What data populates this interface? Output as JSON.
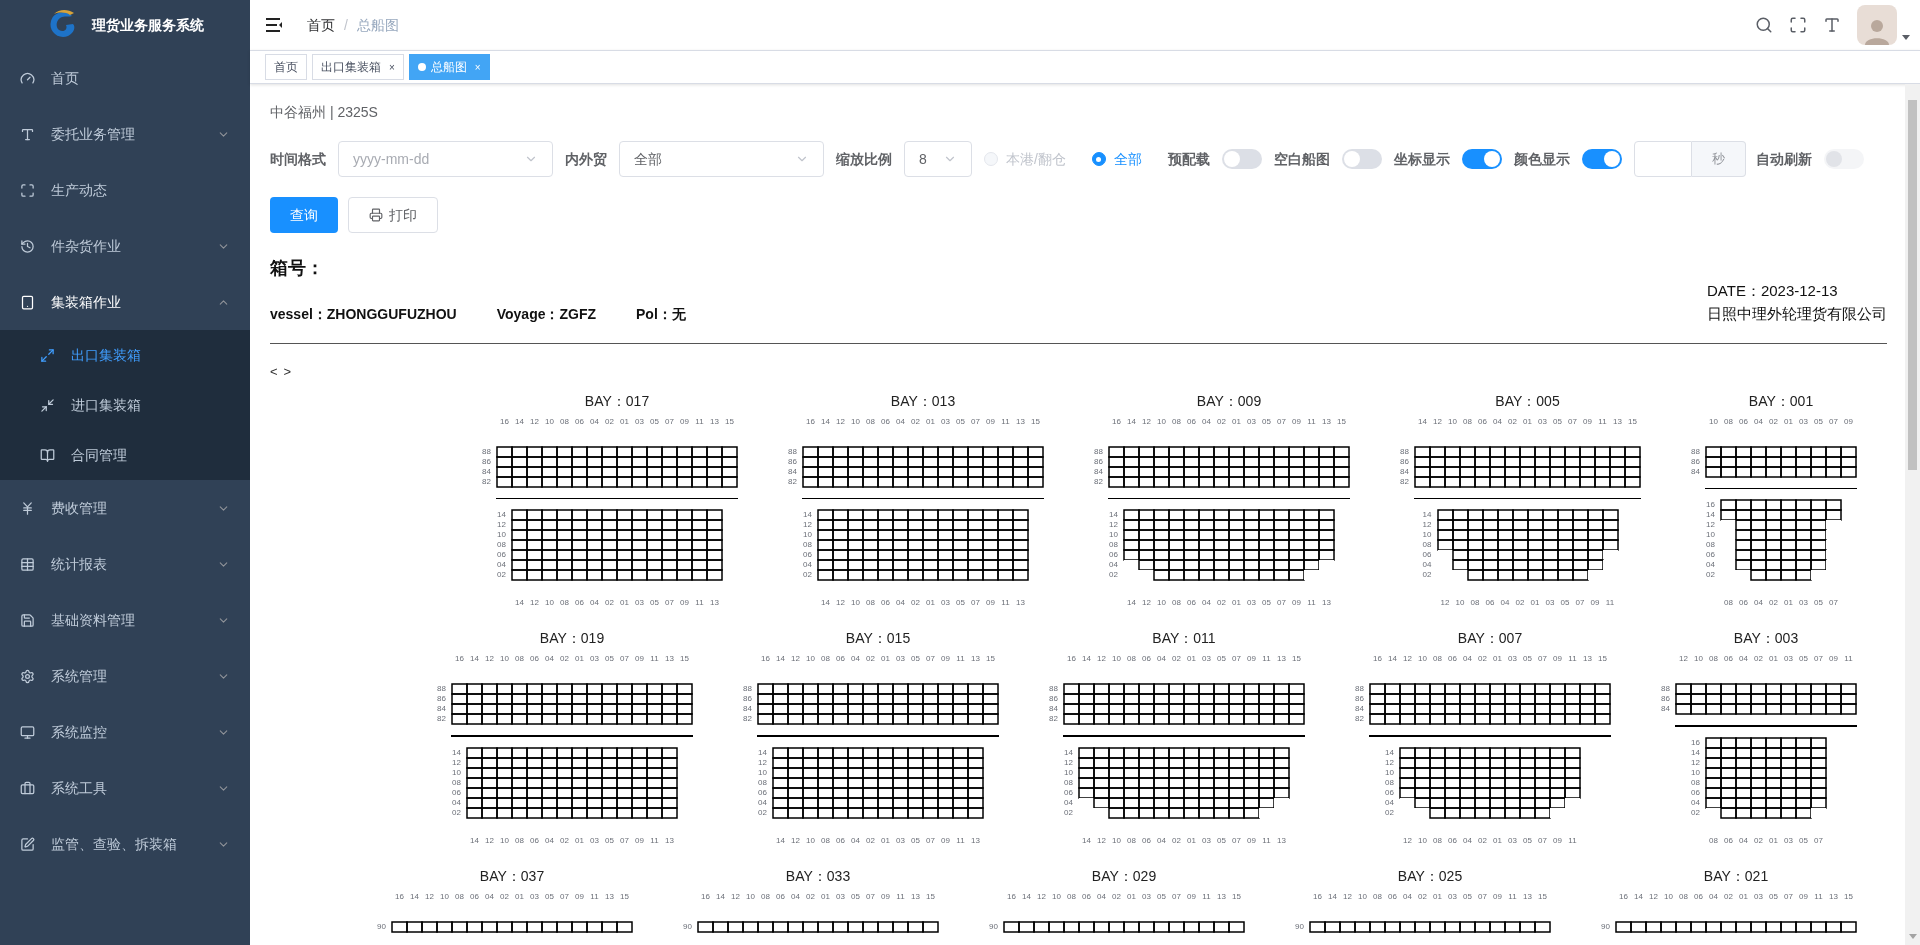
{
  "sidebar": {
    "title": "理货业务服务系统",
    "items": [
      {
        "label": "首页",
        "selected": false
      },
      {
        "label": "委托业务管理",
        "selected": false,
        "expanded": false
      },
      {
        "label": "生产动态",
        "selected": false
      },
      {
        "label": "件杂货作业",
        "selected": false,
        "expanded": false
      },
      {
        "label": "集装箱作业",
        "selected": true,
        "expanded": true,
        "children": [
          {
            "label": "出口集装箱",
            "selected": true
          },
          {
            "label": "进口集装箱",
            "selected": false
          },
          {
            "label": "合同管理",
            "selected": false
          }
        ]
      },
      {
        "label": "费收管理",
        "selected": false,
        "expanded": false
      },
      {
        "label": "统计报表",
        "selected": false,
        "expanded": false
      },
      {
        "label": "基础资料管理",
        "selected": false,
        "expanded": false
      },
      {
        "label": "系统管理",
        "selected": false,
        "expanded": false
      },
      {
        "label": "系统监控",
        "selected": false,
        "expanded": false
      },
      {
        "label": "系统工具",
        "selected": false,
        "expanded": false
      },
      {
        "label": "监管、查验、拆装箱",
        "selected": false,
        "expanded": false
      }
    ]
  },
  "header": {
    "breadcrumb": [
      {
        "label": "首页",
        "current": false
      },
      {
        "label": "总船图",
        "current": true
      }
    ],
    "separator": "/"
  },
  "tags": [
    {
      "label": "首页",
      "selected": false
    },
    {
      "label": "出口集装箱",
      "selected": false,
      "close": "×"
    },
    {
      "label": "总船图",
      "selected": true,
      "close": "×"
    }
  ],
  "page": {
    "ship": "中谷福州 | 2325S",
    "filters": [
      {
        "kind": "select",
        "label": "时间格式",
        "placeholder": "yyyy-mm-dd"
      },
      {
        "kind": "select",
        "label": "内外贸",
        "value": "全部"
      },
      {
        "kind": "select",
        "label": "缩放比例",
        "value": "8"
      },
      {
        "kind": "radio",
        "label": "本港/翻仓",
        "selected": false,
        "disabled": true
      },
      {
        "kind": "radio",
        "label": "全部",
        "selected": true,
        "disabled": false
      },
      {
        "kind": "switch",
        "label": "预配载",
        "on": false,
        "disabled": false
      },
      {
        "kind": "switch",
        "label": "空白船图",
        "on": false,
        "disabled": false
      },
      {
        "kind": "switch",
        "label": "坐标显示",
        "on": true,
        "disabled": false
      },
      {
        "kind": "switch",
        "label": "颜色显示",
        "on": true,
        "disabled": false
      },
      {
        "kind": "input",
        "addon": "秒"
      },
      {
        "kind": "switch",
        "label": "自动刷新",
        "on": false,
        "disabled": true
      }
    ],
    "buttons": [
      {
        "kind": "primary",
        "label": "查询"
      },
      {
        "kind": "print",
        "label": "打印"
      }
    ],
    "info": {
      "heading": "箱号：",
      "vessel": "vessel：ZHONGGUFUZHOU",
      "voyage": "Voyage：ZGFZ",
      "pol": "Pol：无",
      "date": "DATE：2023-12-13",
      "company": "日照中理外轮理货有限公司"
    },
    "pager": [
      "<",
      ">"
    ],
    "bay_rows": [
      [
        {
          "title": "BAY：017",
          "deck_columns": [
            "16",
            "14",
            "12",
            "10",
            "08",
            "06",
            "04",
            "02",
            "01",
            "03",
            "05",
            "07",
            "09",
            "11",
            "13",
            "15"
          ],
          "deck_tiers": [
            "88",
            "86",
            "84",
            "82"
          ],
          "hold_tiers": [
            {
              "label": "14"
            },
            {
              "label": "12"
            },
            {
              "label": "10"
            },
            {
              "label": "08"
            },
            {
              "label": "06"
            },
            {
              "label": "04"
            },
            {
              "label": "02"
            }
          ],
          "hold_columns": [
            "14",
            "12",
            "10",
            "08",
            "06",
            "04",
            "02",
            "01",
            "03",
            "05",
            "07",
            "09",
            "11",
            "13"
          ]
        },
        {
          "title": "BAY：013",
          "deck_columns": [
            "16",
            "14",
            "12",
            "10",
            "08",
            "06",
            "04",
            "02",
            "01",
            "03",
            "05",
            "07",
            "09",
            "11",
            "13",
            "15"
          ],
          "deck_tiers": [
            "88",
            "86",
            "84",
            "82"
          ],
          "hold_tiers": [
            {
              "label": "14"
            },
            {
              "label": "12"
            },
            {
              "label": "10"
            },
            {
              "label": "08"
            },
            {
              "label": "06"
            },
            {
              "label": "04"
            },
            {
              "label": "02"
            }
          ],
          "hold_columns": [
            "14",
            "12",
            "10",
            "08",
            "06",
            "04",
            "02",
            "01",
            "03",
            "05",
            "07",
            "09",
            "11",
            "13"
          ]
        },
        {
          "title": "BAY：009",
          "deck_columns": [
            "16",
            "14",
            "12",
            "10",
            "08",
            "06",
            "04",
            "02",
            "01",
            "03",
            "05",
            "07",
            "09",
            "11",
            "13",
            "15"
          ],
          "deck_tiers": [
            "88",
            "86",
            "84",
            "82"
          ],
          "hold_tiers": [
            {
              "label": "14"
            },
            {
              "label": "12"
            },
            {
              "label": "10"
            },
            {
              "label": "08"
            },
            {
              "label": "06"
            },
            {
              "label": "04",
              "slots": [
                false,
                true,
                true,
                true,
                true,
                true,
                true,
                true,
                true,
                true,
                true,
                true,
                true,
                false
              ]
            },
            {
              "label": "02",
              "slots": [
                false,
                false,
                true,
                true,
                true,
                true,
                true,
                true,
                true,
                true,
                true,
                true,
                false,
                false
              ]
            }
          ],
          "hold_columns": [
            "14",
            "12",
            "10",
            "08",
            "06",
            "04",
            "02",
            "01",
            "03",
            "05",
            "07",
            "09",
            "11",
            "13"
          ]
        },
        {
          "title": "BAY：005",
          "deck_columns": [
            "14",
            "12",
            "10",
            "08",
            "06",
            "04",
            "02",
            "01",
            "03",
            "05",
            "07",
            "09",
            "11",
            "13",
            "15"
          ],
          "deck_tiers": [
            "88",
            "86",
            "84",
            "82"
          ],
          "hold_tiers": [
            {
              "label": "14"
            },
            {
              "label": "12"
            },
            {
              "label": "10"
            },
            {
              "label": "08"
            },
            {
              "label": "06",
              "slots": [
                false,
                true,
                true,
                true,
                true,
                true,
                true,
                true,
                true,
                true,
                true,
                false
              ]
            },
            {
              "label": "04",
              "slots": [
                false,
                true,
                true,
                true,
                true,
                true,
                true,
                true,
                true,
                true,
                true,
                false
              ]
            },
            {
              "label": "02",
              "slots": [
                false,
                false,
                true,
                true,
                true,
                true,
                true,
                true,
                true,
                true,
                false,
                false
              ]
            }
          ],
          "hold_columns": [
            "12",
            "10",
            "08",
            "06",
            "04",
            "02",
            "01",
            "03",
            "05",
            "07",
            "09",
            "11"
          ]
        },
        {
          "title": "BAY：001",
          "deck_columns": [
            "10",
            "08",
            "06",
            "04",
            "02",
            "01",
            "03",
            "05",
            "07",
            "09"
          ],
          "deck_tiers": [
            "88",
            "86",
            "84"
          ],
          "hold_tiers": [
            {
              "label": "16"
            },
            {
              "label": "14"
            },
            {
              "label": "12",
              "slots": [
                false,
                true,
                true,
                true,
                true,
                true,
                true,
                false
              ]
            },
            {
              "label": "10",
              "slots": [
                false,
                true,
                true,
                true,
                true,
                true,
                true,
                false
              ]
            },
            {
              "label": "08",
              "slots": [
                false,
                true,
                true,
                true,
                true,
                true,
                true,
                false
              ]
            },
            {
              "label": "06",
              "slots": [
                false,
                true,
                true,
                true,
                true,
                true,
                true,
                false
              ]
            },
            {
              "label": "04",
              "slots": [
                false,
                true,
                true,
                true,
                true,
                true,
                true,
                false
              ]
            },
            {
              "label": "02",
              "slots": [
                false,
                false,
                true,
                true,
                true,
                true,
                false,
                false
              ]
            }
          ],
          "hold_columns": [
            "08",
            "06",
            "04",
            "02",
            "01",
            "03",
            "05",
            "07"
          ]
        }
      ],
      [
        {
          "title": "BAY：019",
          "deck_columns": [
            "16",
            "14",
            "12",
            "10",
            "08",
            "06",
            "04",
            "02",
            "01",
            "03",
            "05",
            "07",
            "09",
            "11",
            "13",
            "15"
          ],
          "deck_tiers": [
            "88",
            "86",
            "84",
            "82"
          ],
          "hold_tiers": [
            {
              "label": "14"
            },
            {
              "label": "12"
            },
            {
              "label": "10"
            },
            {
              "label": "08"
            },
            {
              "label": "06"
            },
            {
              "label": "04"
            },
            {
              "label": "02"
            }
          ],
          "hold_columns": [
            "14",
            "12",
            "10",
            "08",
            "06",
            "04",
            "02",
            "01",
            "03",
            "05",
            "07",
            "09",
            "11",
            "13"
          ]
        },
        {
          "title": "BAY：015",
          "deck_columns": [
            "16",
            "14",
            "12",
            "10",
            "08",
            "06",
            "04",
            "02",
            "01",
            "03",
            "05",
            "07",
            "09",
            "11",
            "13",
            "15"
          ],
          "deck_tiers": [
            "88",
            "86",
            "84",
            "82"
          ],
          "hold_tiers": [
            {
              "label": "14"
            },
            {
              "label": "12"
            },
            {
              "label": "10"
            },
            {
              "label": "08"
            },
            {
              "label": "06"
            },
            {
              "label": "04"
            },
            {
              "label": "02"
            }
          ],
          "hold_columns": [
            "14",
            "12",
            "10",
            "08",
            "06",
            "04",
            "02",
            "01",
            "03",
            "05",
            "07",
            "09",
            "11",
            "13"
          ]
        },
        {
          "title": "BAY：011",
          "deck_columns": [
            "16",
            "14",
            "12",
            "10",
            "08",
            "06",
            "04",
            "02",
            "01",
            "03",
            "05",
            "07",
            "09",
            "11",
            "13",
            "15"
          ],
          "deck_tiers": [
            "88",
            "86",
            "84",
            "82"
          ],
          "hold_tiers": [
            {
              "label": "14"
            },
            {
              "label": "12"
            },
            {
              "label": "10"
            },
            {
              "label": "08"
            },
            {
              "label": "06"
            },
            {
              "label": "04",
              "slots": [
                false,
                true,
                true,
                true,
                true,
                true,
                true,
                true,
                true,
                true,
                true,
                true,
                true,
                false
              ]
            },
            {
              "label": "02",
              "slots": [
                false,
                false,
                true,
                true,
                true,
                true,
                true,
                true,
                true,
                true,
                true,
                true,
                false,
                false
              ]
            }
          ],
          "hold_columns": [
            "14",
            "12",
            "10",
            "08",
            "06",
            "04",
            "02",
            "01",
            "03",
            "05",
            "07",
            "09",
            "11",
            "13"
          ]
        },
        {
          "title": "BAY：007",
          "deck_columns": [
            "16",
            "14",
            "12",
            "10",
            "08",
            "06",
            "04",
            "02",
            "01",
            "03",
            "05",
            "07",
            "09",
            "11",
            "13",
            "15"
          ],
          "deck_tiers": [
            "88",
            "86",
            "84",
            "82"
          ],
          "hold_tiers": [
            {
              "label": "14"
            },
            {
              "label": "12"
            },
            {
              "label": "10"
            },
            {
              "label": "08"
            },
            {
              "label": "06"
            },
            {
              "label": "04",
              "slots": [
                false,
                true,
                true,
                true,
                true,
                true,
                true,
                true,
                true,
                true,
                true,
                false
              ]
            },
            {
              "label": "02",
              "slots": [
                false,
                false,
                true,
                true,
                true,
                true,
                true,
                true,
                true,
                true,
                false,
                false
              ]
            }
          ],
          "hold_columns": [
            "12",
            "10",
            "08",
            "06",
            "04",
            "02",
            "01",
            "03",
            "05",
            "07",
            "09",
            "11"
          ]
        },
        {
          "title": "BAY：003",
          "deck_columns": [
            "12",
            "10",
            "08",
            "06",
            "04",
            "02",
            "01",
            "03",
            "05",
            "07",
            "09",
            "11"
          ],
          "deck_tiers": [
            "88",
            "86",
            "84"
          ],
          "hold_tiers": [
            {
              "label": "16"
            },
            {
              "label": "14"
            },
            {
              "label": "12"
            },
            {
              "label": "10"
            },
            {
              "label": "08"
            },
            {
              "label": "06"
            },
            {
              "label": "04"
            },
            {
              "label": "02",
              "slots": [
                false,
                true,
                true,
                true,
                true,
                true,
                true,
                false
              ]
            }
          ],
          "hold_columns": [
            "08",
            "06",
            "04",
            "02",
            "01",
            "03",
            "05",
            "07"
          ]
        }
      ],
      [
        {
          "title": "BAY：037",
          "deck_columns": [
            "16",
            "14",
            "12",
            "10",
            "08",
            "06",
            "04",
            "02",
            "01",
            "03",
            "05",
            "07",
            "09",
            "11",
            "13",
            "15"
          ],
          "deck_tiers": [
            "90"
          ]
        },
        {
          "title": "BAY：033",
          "deck_columns": [
            "16",
            "14",
            "12",
            "10",
            "08",
            "06",
            "04",
            "02",
            "01",
            "03",
            "05",
            "07",
            "09",
            "11",
            "13",
            "15"
          ],
          "deck_tiers": [
            "90"
          ]
        },
        {
          "title": "BAY：029",
          "deck_columns": [
            "16",
            "14",
            "12",
            "10",
            "08",
            "06",
            "04",
            "02",
            "01",
            "03",
            "05",
            "07",
            "09",
            "11",
            "13",
            "15"
          ],
          "deck_tiers": [
            "90"
          ]
        },
        {
          "title": "BAY：025",
          "deck_columns": [
            "16",
            "14",
            "12",
            "10",
            "08",
            "06",
            "04",
            "02",
            "01",
            "03",
            "05",
            "07",
            "09",
            "11",
            "13",
            "15"
          ],
          "deck_tiers": [
            "90"
          ]
        },
        {
          "title": "BAY：021",
          "deck_columns": [
            "16",
            "14",
            "12",
            "10",
            "08",
            "06",
            "04",
            "02",
            "01",
            "03",
            "05",
            "07",
            "09",
            "11",
            "13",
            "15"
          ],
          "deck_tiers": [
            "90"
          ]
        }
      ]
    ]
  }
}
